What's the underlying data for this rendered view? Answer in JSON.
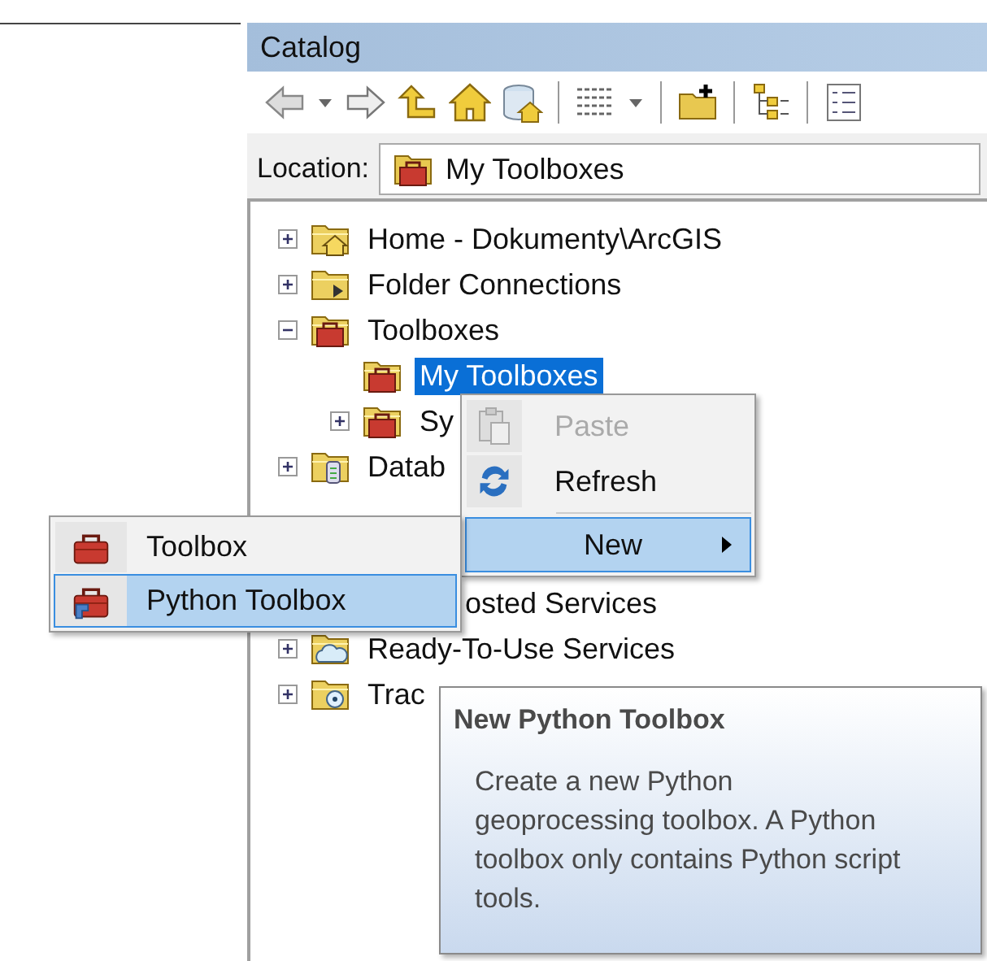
{
  "panel": {
    "title": "Catalog"
  },
  "toolbar": [
    {
      "kind": "back"
    },
    {
      "kind": "caret"
    },
    {
      "kind": "forward"
    },
    {
      "kind": "up"
    },
    {
      "kind": "home"
    },
    {
      "kind": "dbhome"
    },
    {
      "kind": "sep"
    },
    {
      "kind": "grid"
    },
    {
      "kind": "caret"
    },
    {
      "kind": "sep"
    },
    {
      "kind": "connect"
    },
    {
      "kind": "sep"
    },
    {
      "kind": "tree"
    },
    {
      "kind": "sep"
    },
    {
      "kind": "details"
    }
  ],
  "location": {
    "label": "Location:",
    "value": "My Toolboxes"
  },
  "tree": [
    {
      "label": "Home - Dokumenty\\ArcGIS",
      "kind": "home",
      "expanded": false,
      "selected": false
    },
    {
      "label": "Folder Connections",
      "kind": "connections",
      "expanded": false,
      "selected": false
    },
    {
      "label": "Toolboxes",
      "kind": "toolbox",
      "expanded": true,
      "selected": false,
      "children": [
        {
          "label": "My Toolboxes",
          "kind": "toolbox",
          "selected": true
        },
        {
          "label": "Sy",
          "kind": "toolbox",
          "expanded": false,
          "selected": false
        }
      ]
    },
    {
      "label": "Datab",
      "kind": "database",
      "expanded": false,
      "selected": false
    },
    {
      "label": "osted Services",
      "kind": "covered",
      "selected": false
    },
    {
      "label": "Ready-To-Use Services",
      "kind": "cloud",
      "expanded": false,
      "selected": false
    },
    {
      "label": "Trac",
      "kind": "tracking",
      "expanded": false,
      "selected": false
    }
  ],
  "context_menu": [
    {
      "label": "Paste",
      "kind": "paste",
      "disabled": true,
      "selected": false
    },
    {
      "label": "Refresh",
      "kind": "refresh",
      "disabled": false,
      "selected": false
    },
    {
      "label": "New",
      "kind": "submenu",
      "disabled": false,
      "selected": true
    }
  ],
  "submenu": [
    {
      "label": "Toolbox",
      "kind": "toolbox",
      "selected": false
    },
    {
      "label": "Python Toolbox",
      "kind": "pytoolbox",
      "selected": true
    }
  ],
  "tooltip": {
    "title": "New Python Toolbox",
    "text": "Create a new Python geoprocessing toolbox. A Python toolbox only contains Python script tools."
  }
}
